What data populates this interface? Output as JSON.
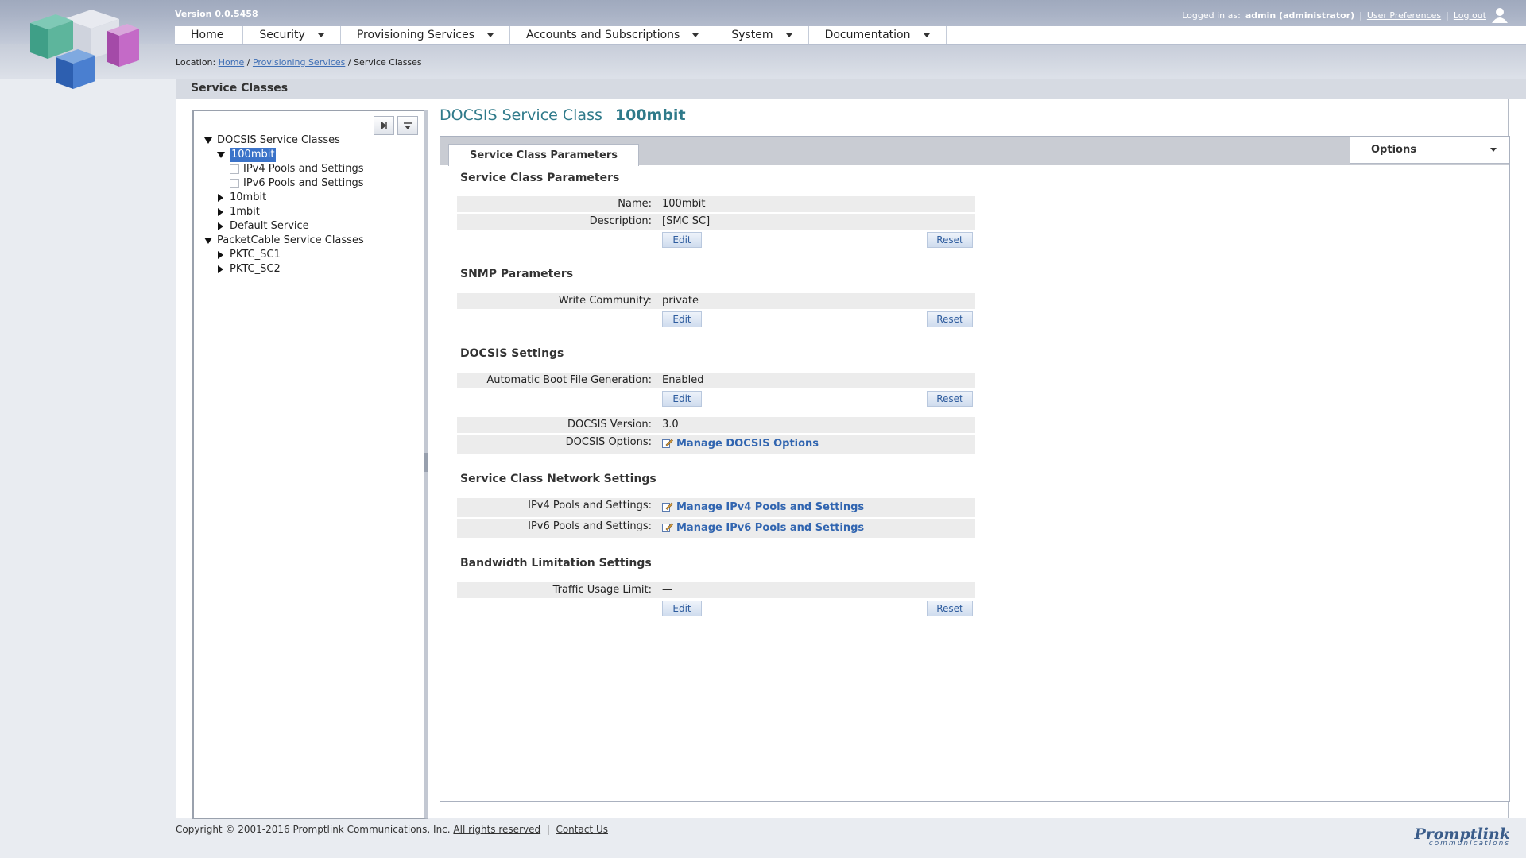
{
  "header": {
    "version": "Version 0.0.5458",
    "logged_in_label": "Logged in as:",
    "user": "admin (administrator)",
    "user_preferences": "User Preferences",
    "logout": "Log out",
    "separator": "|"
  },
  "nav": {
    "home": "Home",
    "security": "Security",
    "provisioning": "Provisioning Services",
    "accounts": "Accounts and Subscriptions",
    "system": "System",
    "documentation": "Documentation"
  },
  "breadcrumb": {
    "label": "Location:",
    "home": "Home",
    "sep": "/",
    "provisioning": "Provisioning Services",
    "current": "Service Classes"
  },
  "section_title": "Service Classes",
  "tree": {
    "docsis": "DOCSIS Service Classes",
    "selected": "100mbit",
    "ipv4": "IPv4 Pools and Settings",
    "ipv6": "IPv6 Pools and Settings",
    "n10mbit": "10mbit",
    "n1mbit": "1mbit",
    "default": "Default Service",
    "packetcable": "PacketCable Service Classes",
    "pktc1": "PKTC_SC1",
    "pktc2": "PKTC_SC2"
  },
  "detail": {
    "title_prefix": "DOCSIS Service Class",
    "title_name": "100mbit",
    "tab": "Service Class Parameters",
    "options": "Options",
    "edit": "Edit",
    "reset": "Reset",
    "g1": {
      "title": "Service Class Parameters",
      "name_k": "Name:",
      "name_v": "100mbit",
      "desc_k": "Description:",
      "desc_v": "[SMC SC]"
    },
    "g2": {
      "title": "SNMP Parameters",
      "wc_k": "Write Community:",
      "wc_v": "private"
    },
    "g3": {
      "title": "DOCSIS Settings",
      "boot_k": "Automatic Boot File Generation:",
      "boot_v": "Enabled",
      "ver_k": "DOCSIS Version:",
      "ver_v": "3.0",
      "opt_k": "DOCSIS Options:",
      "opt_v": "Manage DOCSIS Options"
    },
    "g4": {
      "title": "Service Class Network Settings",
      "ipv4_k": "IPv4 Pools and Settings:",
      "ipv4_v": "Manage IPv4 Pools and Settings",
      "ipv6_k": "IPv6 Pools and Settings:",
      "ipv6_v": "Manage IPv6 Pools and Settings"
    },
    "g5": {
      "title": "Bandwidth Limitation Settings",
      "tul_k": "Traffic Usage Limit:",
      "tul_v": "—"
    }
  },
  "footer": {
    "copyright": "Copyright © 2001-2016 Promptlink Communications, Inc.",
    "rights": "All rights reserved",
    "sep": "|",
    "contact": "Contact Us",
    "brand": "Promptlink",
    "brand_sub": "communications"
  },
  "colors": {
    "accent": "#2f7a8a",
    "link": "#3165b0",
    "selection": "#3b73c9"
  }
}
